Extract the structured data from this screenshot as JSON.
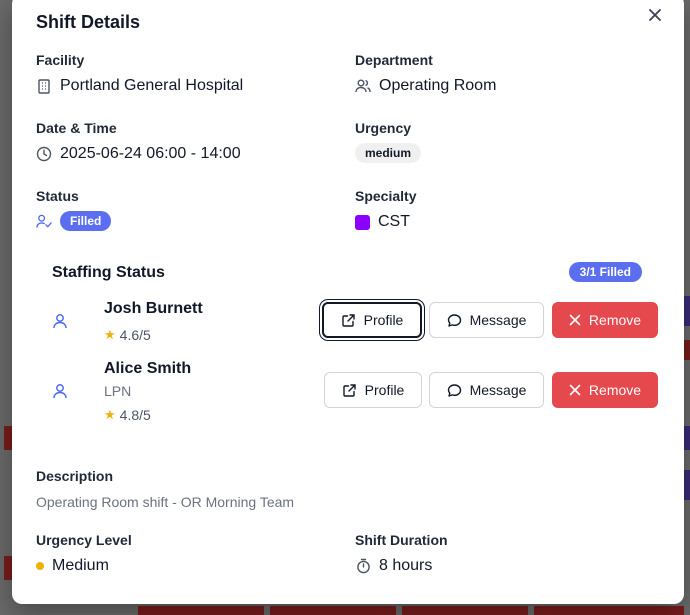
{
  "modal": {
    "title": "Shift Details"
  },
  "fields": {
    "facility": {
      "label": "Facility",
      "value": "Portland General Hospital",
      "icon": "building-icon"
    },
    "department": {
      "label": "Department",
      "value": "Operating Room",
      "icon": "users-icon"
    },
    "datetime": {
      "label": "Date & Time",
      "value": "2025-06-24 06:00 - 14:00",
      "icon": "clock-icon"
    },
    "urgency": {
      "label": "Urgency",
      "badge": "medium"
    },
    "status": {
      "label": "Status",
      "badge": "Filled",
      "icon": "user-check-icon"
    },
    "specialty": {
      "label": "Specialty",
      "value": "CST",
      "color": "#8b00ff"
    }
  },
  "staffing": {
    "title": "Staffing Status",
    "count_badge": "3/1 Filled",
    "members": [
      {
        "name": "Josh Burnett",
        "role": "",
        "rating": "4.6/5"
      },
      {
        "name": "Alice Smith",
        "role": "LPN",
        "rating": "4.8/5"
      }
    ],
    "actions": {
      "profile": "Profile",
      "message": "Message",
      "remove": "Remove"
    }
  },
  "description": {
    "label": "Description",
    "text": "Operating Room shift - OR Morning Team"
  },
  "urgency_level": {
    "label": "Urgency Level",
    "value": "Medium",
    "color": "#eab308"
  },
  "shift_duration": {
    "label": "Shift Duration",
    "value": "8 hours",
    "icon": "timer-icon"
  },
  "colors": {
    "accent": "#5b6ef0",
    "danger": "#e5484d"
  }
}
